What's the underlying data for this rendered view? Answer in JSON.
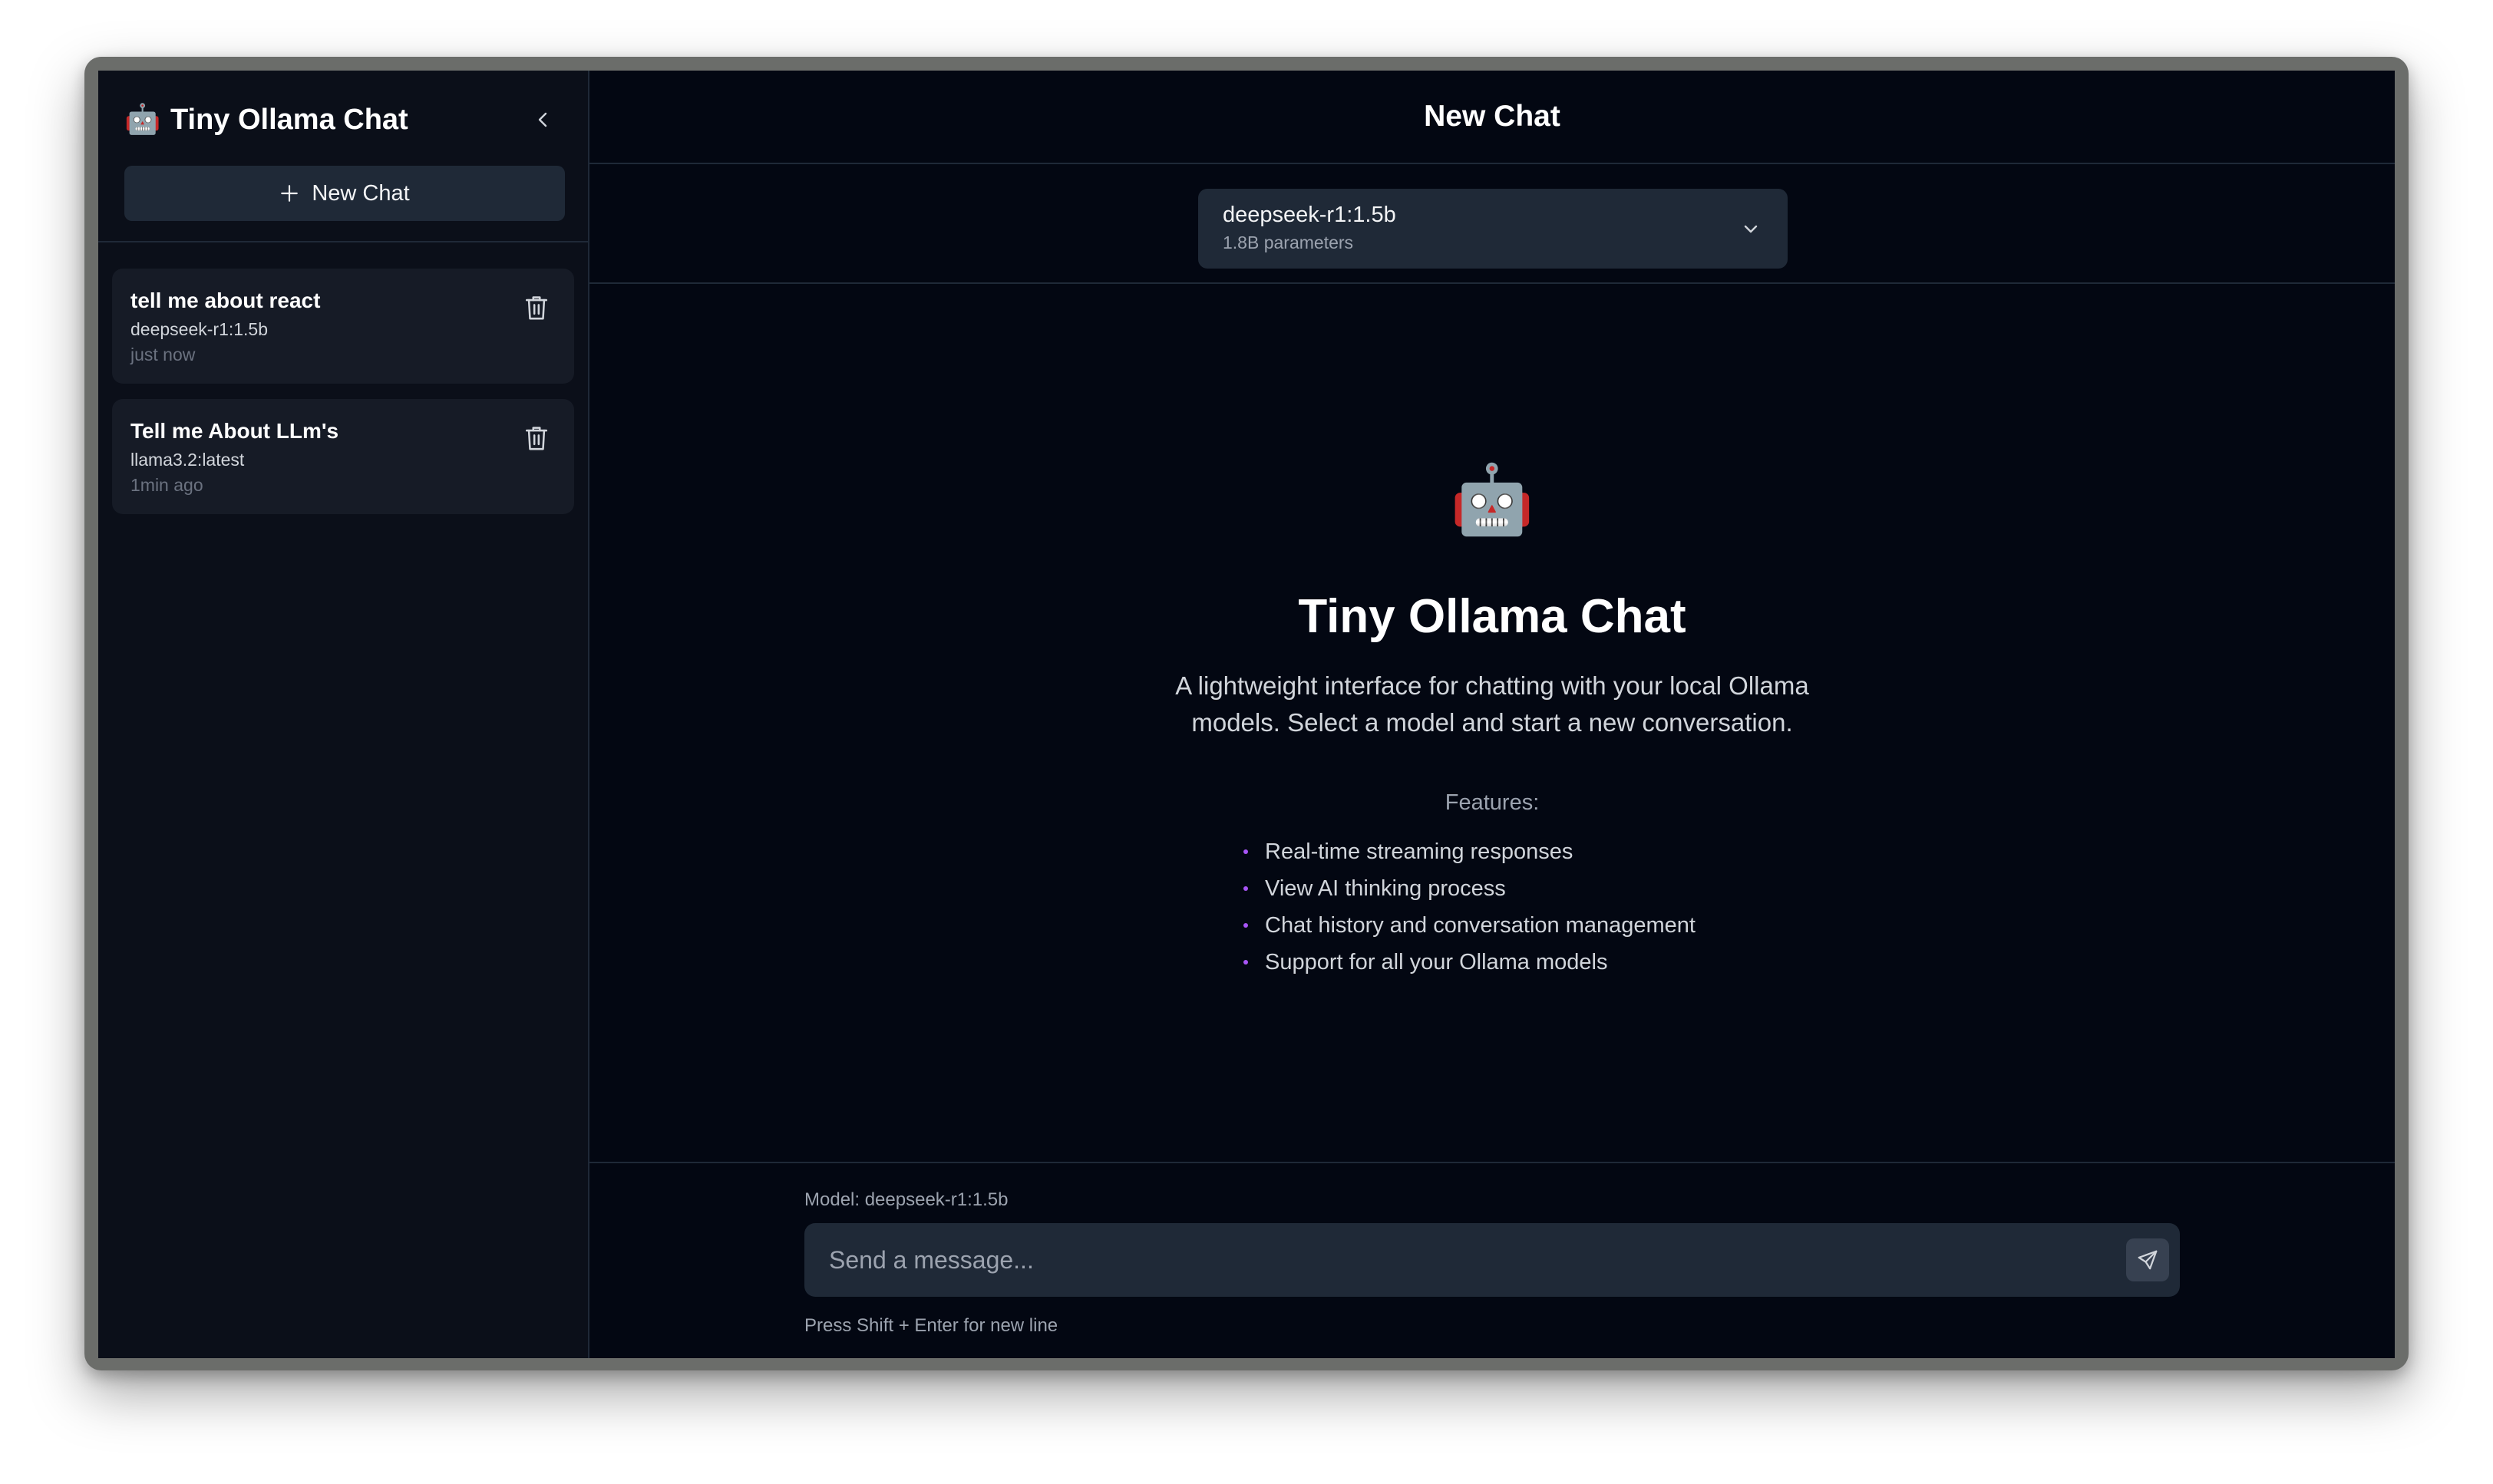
{
  "sidebar": {
    "title": "Tiny Ollama Chat",
    "logo_emoji": "🤖",
    "new_chat_label": "New Chat",
    "chats": [
      {
        "title": "tell me about react",
        "model": "deepseek-r1:1.5b",
        "time": "just now"
      },
      {
        "title": "Tell me About LLm's",
        "model": "llama3.2:latest",
        "time": "1min ago"
      }
    ]
  },
  "header": {
    "title": "New Chat"
  },
  "model_select": {
    "name": "deepseek-r1:1.5b",
    "params": "1.8B parameters"
  },
  "welcome": {
    "emoji": "🤖",
    "title": "Tiny Ollama Chat",
    "description": "A lightweight interface for chatting with your local Ollama models. Select a model and start a new conversation.",
    "features_label": "Features:",
    "features": [
      "Real-time streaming responses",
      "View AI thinking process",
      "Chat history and conversation management",
      "Support for all your Ollama models"
    ]
  },
  "composer": {
    "model_label": "Model: deepseek-r1:1.5b",
    "placeholder": "Send a message...",
    "hint": "Press Shift + Enter for new line"
  },
  "colors": {
    "background": "#030712",
    "sidebar": "#0b0f19",
    "surface": "#1f2937",
    "accent": "#a855f7"
  }
}
